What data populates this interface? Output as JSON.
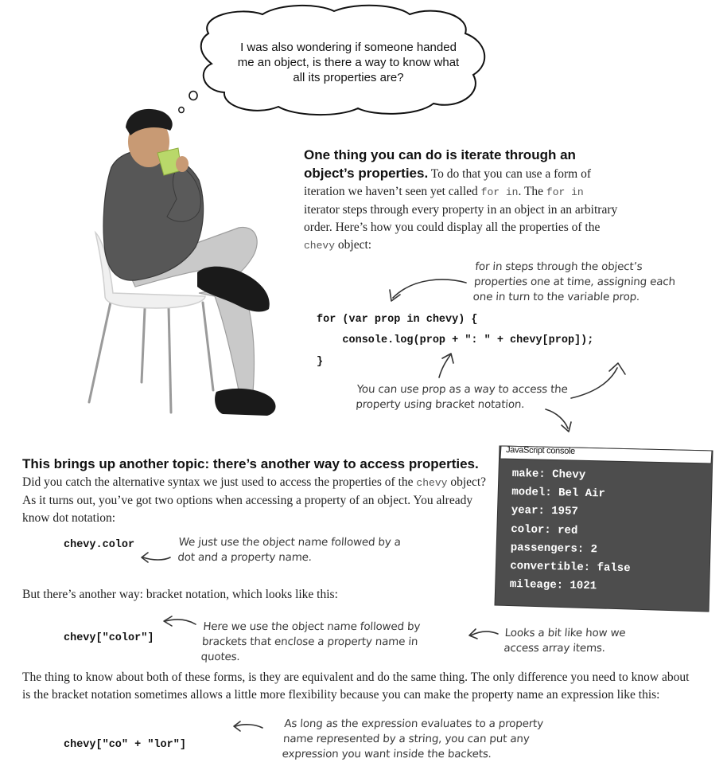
{
  "thought_bubble": {
    "text": "I was also wondering if someone handed me an object, is there a way to know what all its properties are?"
  },
  "intro": {
    "heading": "One thing you can do is iterate through an object’s properties.",
    "body_1": " To do that you can use a form of iteration we haven’t seen yet called ",
    "code_1": "for in",
    "body_2": ". The ",
    "code_2": "for in",
    "body_3": " iterator steps through every property in an object in an arbitrary order. Here’s how you could display all the properties of the ",
    "code_3": "chevy",
    "body_4": " object:"
  },
  "code_example": {
    "line1": "for (var prop in chevy) {",
    "line2": "    console.log(prop + \": \" + chevy[prop]);",
    "line3": "}"
  },
  "annotations": {
    "for_in": "for in steps through the object’s properties one at time, assigning each one in turn to the variable prop.",
    "bracket_access": "You can use prop as a way to access the property using bracket notation.",
    "dot": "We just use the object name followed by a dot and a property name.",
    "bracket": "Here we use the object name followed by brackets that enclose a property name in quotes.",
    "array": "Looks a bit like how we access array items.",
    "expression": "As long as the expression evaluates to a property name represented by a string, you can put any expression you want inside the backets."
  },
  "console": {
    "title": "JavaScript console",
    "lines": [
      "make: Chevy",
      "model: Bel Air",
      "year: 1957",
      "color: red",
      "passengers: 2",
      "convertible: false",
      "mileage: 1021"
    ]
  },
  "section2": {
    "heading": "This brings up another topic: there’s another way to access properties.",
    "body_1": " Did you catch the alternative syntax we just used to access the properties of the ",
    "code_1": "chevy",
    "body_2": " object? As it turns out, you’ve got two options when accessing a property of an object. You already know dot notation:",
    "dot_code": "chevy.color",
    "bracket_intro": "But there’s another way: bracket notation, which looks like this:",
    "bracket_code": "chevy[\"color\"]",
    "equivalence": "The thing to know about both of these forms, is they are equivalent and do the same thing. The only difference you need to know about is the bracket notation sometimes allows a little more flexibility because you can make the property name an expression like this:",
    "expr_code": "chevy[\"co\" + \"lor\"]"
  }
}
